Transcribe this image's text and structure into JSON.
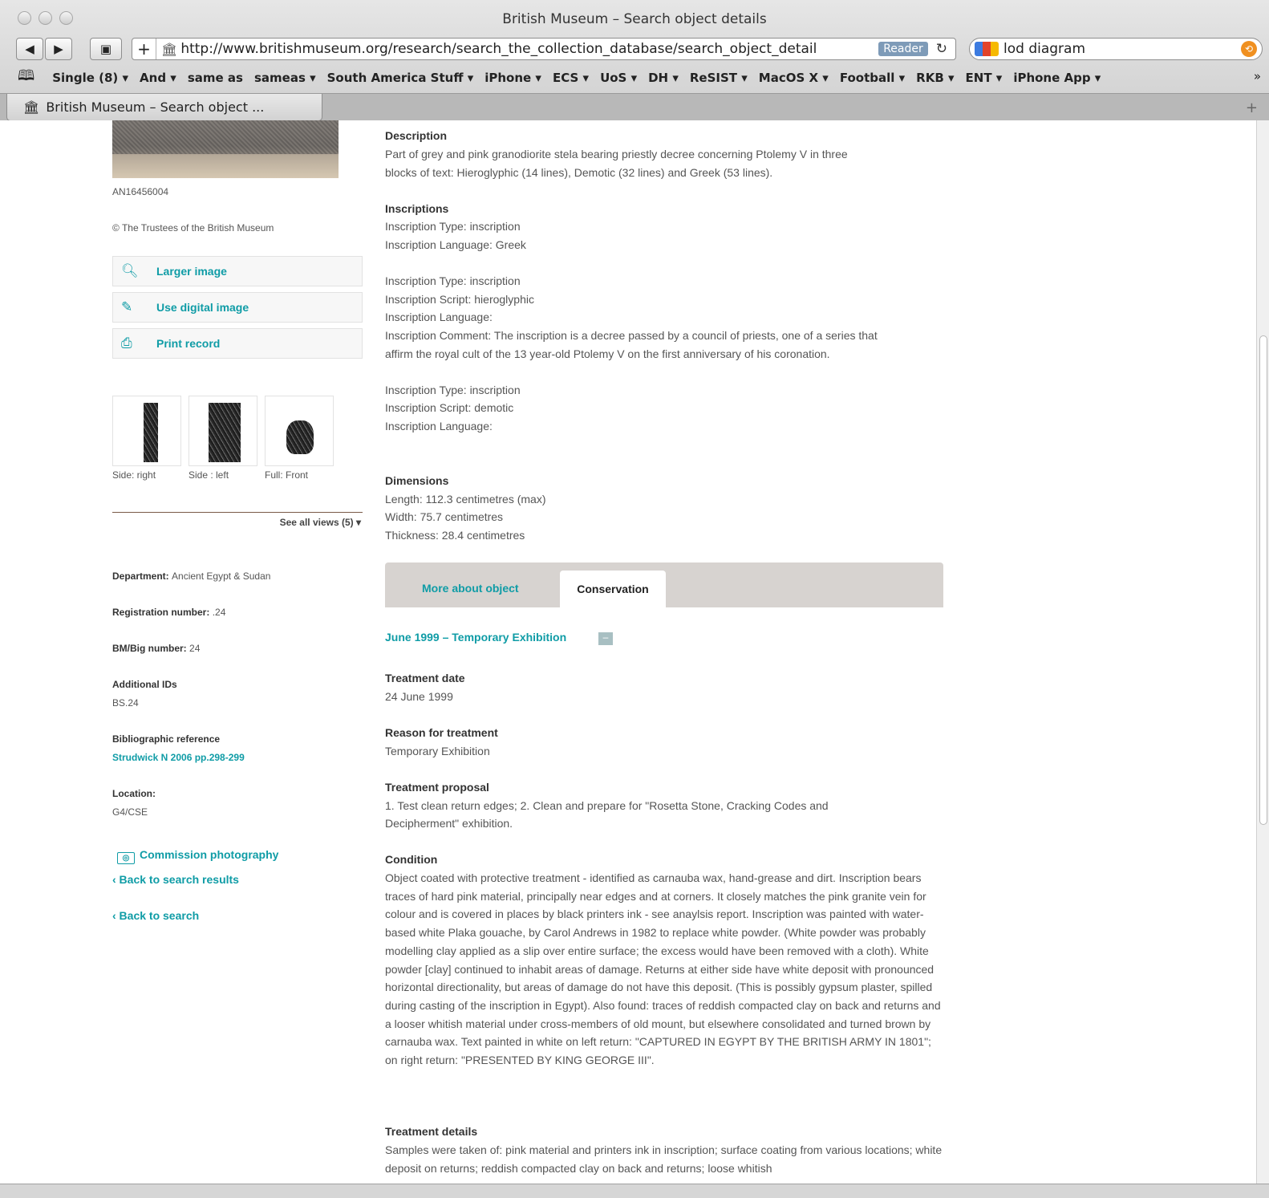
{
  "window": {
    "title": "British Museum – Search object details"
  },
  "toolbar": {
    "url": "http://www.britishmuseum.org/research/search_the_collection_database/search_object_detail",
    "reader_label": "Reader",
    "search_value": "lod diagram"
  },
  "bookmarks": [
    "Single (8) ▾",
    "And ▾",
    "same as",
    "sameas ▾",
    "South America Stuff ▾",
    "iPhone ▾",
    "ECS ▾",
    "UoS ▾",
    "DH ▾",
    "ReSIST ▾",
    "MacOS X ▾",
    "Football ▾",
    "RKB ▾",
    "ENT ▾",
    "iPhone App ▾"
  ],
  "tab": {
    "title": "British Museum – Search object ..."
  },
  "left": {
    "image_id": "AN16456004",
    "copyright": "© The Trustees of the British Museum",
    "actions": {
      "larger": "Larger image",
      "digital": "Use digital image",
      "print": "Print record"
    },
    "thumbs": [
      "Side: right",
      "Side : left",
      "Full: Front"
    ],
    "see_all": "See all views (5) ▾",
    "department_label": "Department:",
    "department": "Ancient Egypt & Sudan",
    "registration_label": "Registration number:",
    "registration": ".24",
    "bigno_label": "BM/Big number:",
    "bigno": "24",
    "addids_label": "Additional IDs",
    "addids": "BS.24",
    "biblio_label": "Bibliographic reference",
    "biblio": "Strudwick N 2006 pp.298-299",
    "location_label": "Location:",
    "location": "G4/CSE",
    "commission": "Commission photography",
    "back_results": "‹ Back to search results",
    "back_search": "‹ Back to search"
  },
  "main": {
    "desc_h": "Description",
    "desc_1": "Part of grey and pink granodiorite stela bearing priestly decree concerning Ptolemy V in three",
    "desc_2": "blocks of text: Hieroglyphic (14 lines), Demotic (32 lines) and Greek (53 lines).",
    "insc_h": "Inscriptions",
    "insc_1a": "Inscription Type: inscription",
    "insc_1b": "Inscription Language: Greek",
    "insc_2a": "Inscription Type: inscription",
    "insc_2b": "Inscription Script: hieroglyphic",
    "insc_2c": "Inscription Language:",
    "insc_2d": "Inscription Comment: The inscription is a decree passed by a council of priests, one of a series that",
    "insc_2e": "affirm the royal cult of the 13 year-old Ptolemy V on the first anniversary of his coronation.",
    "insc_3a": "Inscription Type: inscription",
    "insc_3b": "Inscription Script: demotic",
    "insc_3c": "Inscription Language:",
    "dim_h": "Dimensions",
    "dim_1": "Length: 112.3 centimetres (max)",
    "dim_2": "Width: 75.7 centimetres",
    "dim_3": "Thickness: 28.4 centimetres",
    "tab_more": "More about object",
    "tab_cons": "Conservation",
    "exhib": "June 1999 – Temporary Exhibition",
    "exhib_toggle": "–",
    "tdate_h": "Treatment date",
    "tdate": "24 June 1999",
    "reason_h": "Reason for treatment",
    "reason": "Temporary Exhibition",
    "proposal_h": "Treatment proposal",
    "proposal_1": "1. Test clean return edges; 2. Clean and prepare for \"Rosetta Stone, Cracking Codes and",
    "proposal_2": "Decipherment\" exhibition.",
    "condition_h": "Condition",
    "condition": "Object coated with protective treatment - identified as carnauba wax, hand-grease and dirt. Inscription bears traces of hard pink material, principally near edges and at corners. It closely matches the pink granite vein for colour and is covered in places by black printers ink - see anaylsis report. Inscription was painted with water-based white Plaka gouache, by Carol Andrews in 1982 to replace white powder. (White powder was probably modelling clay applied as a slip over entire surface; the excess would have been removed with a cloth). White powder [clay] continued to inhabit areas of damage. Returns at either side have white deposit with pronounced horizontal directionality, but areas of damage do not have this deposit. (This is possibly gypsum plaster, spilled during casting of the inscription in Egypt). Also found: traces of reddish compacted clay on back and returns and a looser whitish material under cross-members of old mount, but elsewhere consolidated and turned brown by carnauba wax. Text painted in white on left return: \"CAPTURED IN EGYPT BY THE BRITISH ARMY IN 1801\"; on right return: \"PRESENTED BY KING GEORGE III\".",
    "details_h": "Treatment details",
    "details": "Samples were taken of: pink material and printers ink in inscription; surface coating from various locations; white deposit on returns; reddish compacted clay on back and returns; loose whitish"
  }
}
